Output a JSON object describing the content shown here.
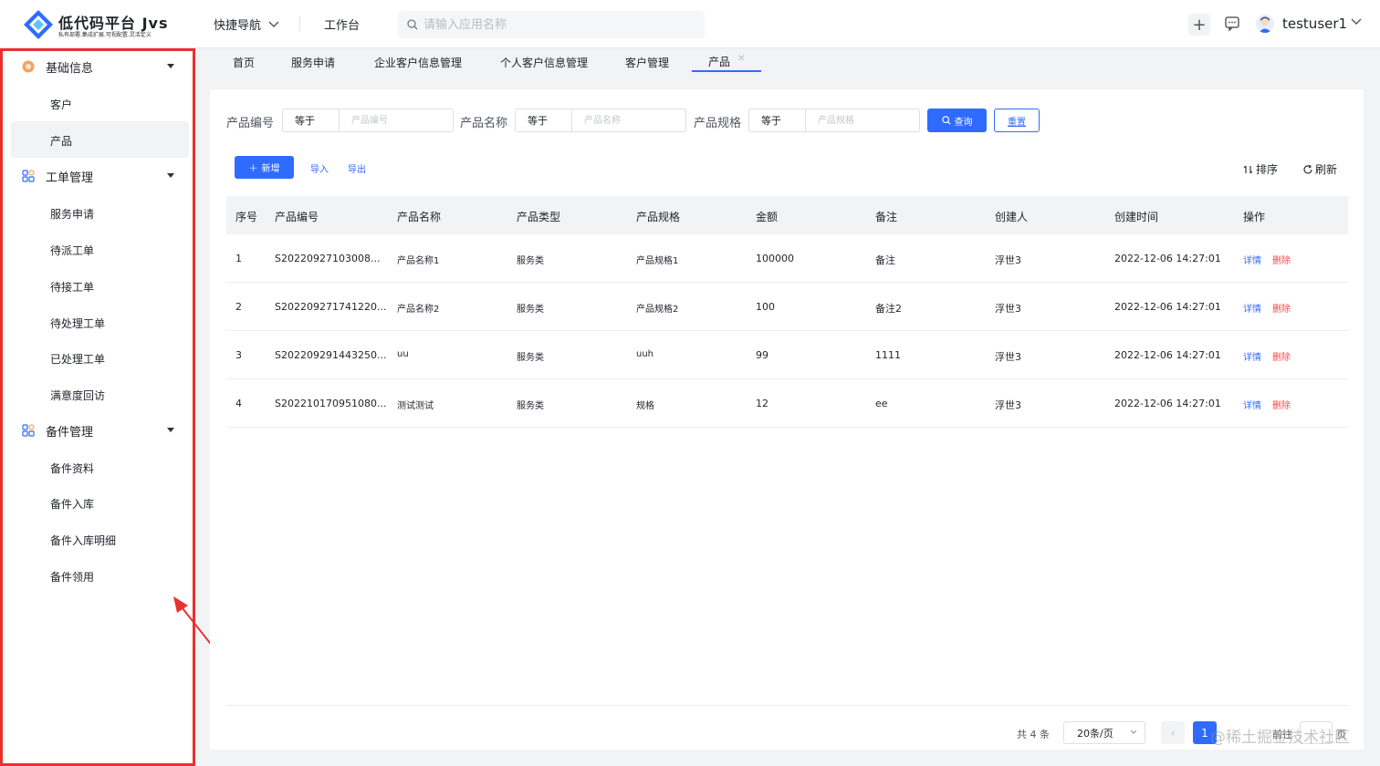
{
  "header": {
    "brand_title": "低代码平台 Jvs",
    "brand_subtitle": "私有部署.集成扩展.可视配置.灵活定义",
    "nav_quick": "快捷导航",
    "nav_workbench": "工作台",
    "search_placeholder": "请输入应用名称",
    "username": "testuser1"
  },
  "sidebar": {
    "groups": [
      {
        "label": "基础信息",
        "icon": "base-info-icon",
        "items": [
          "客户",
          "产品"
        ]
      },
      {
        "label": "工单管理",
        "icon": "grid-icon",
        "items": [
          "服务申请",
          "待派工单",
          "待接工单",
          "待处理工单",
          "已处理工单",
          "满意度回访"
        ]
      },
      {
        "label": "备件管理",
        "icon": "grid-icon",
        "items": [
          "备件资料",
          "备件入库",
          "备件入库明细",
          "备件领用"
        ]
      }
    ],
    "active_item": "产品"
  },
  "tabs": [
    "首页",
    "服务申请",
    "企业客户信息管理",
    "个人客户信息管理",
    "客户管理",
    "产品"
  ],
  "active_tab": "产品",
  "filters": [
    {
      "label": "产品编号",
      "operator": "等于",
      "placeholder": "产品编号"
    },
    {
      "label": "产品名称",
      "operator": "等于",
      "placeholder": "产品名称"
    },
    {
      "label": "产品规格",
      "operator": "等于",
      "placeholder": "产品规格"
    }
  ],
  "buttons": {
    "query": "查询",
    "reset": "重置",
    "add": "新增",
    "import": "导入",
    "export": "导出",
    "sort": "排序",
    "refresh": "刷新"
  },
  "table": {
    "columns": [
      "序号",
      "产品编号",
      "产品名称",
      "产品类型",
      "产品规格",
      "金额",
      "备注",
      "创建人",
      "创建时间",
      "操作"
    ],
    "rows": [
      [
        "1",
        "S20220927103008...",
        "产品名称1",
        "服务类",
        "产品规格1",
        "100000",
        "备注",
        "浮世3",
        "2022-12-06 14:27:01"
      ],
      [
        "2",
        "S202209271741220...",
        "产品名称2",
        "服务类",
        "产品规格2",
        "100",
        "备注2",
        "浮世3",
        "2022-12-06 14:27:01"
      ],
      [
        "3",
        "S202209291443250...",
        "uu",
        "服务类",
        "uuh",
        "99",
        "1111",
        "浮世3",
        "2022-12-06 14:27:01"
      ],
      [
        "4",
        "S202210170951080...",
        "测试测试",
        "服务类",
        "规格",
        "12",
        "ee",
        "浮世3",
        "2022-12-06 14:27:01"
      ]
    ],
    "action_detail": "详情",
    "action_delete": "删除"
  },
  "pagination": {
    "total": "共 4 条",
    "page_size": "20条/页",
    "current_page": "1",
    "goto": "前往",
    "page_suffix": "页"
  },
  "watermark": "@稀土掘金技术社区",
  "colors": {
    "primary": "#2f6bff",
    "danger": "#f5484a",
    "annotation": "#e8312f"
  }
}
